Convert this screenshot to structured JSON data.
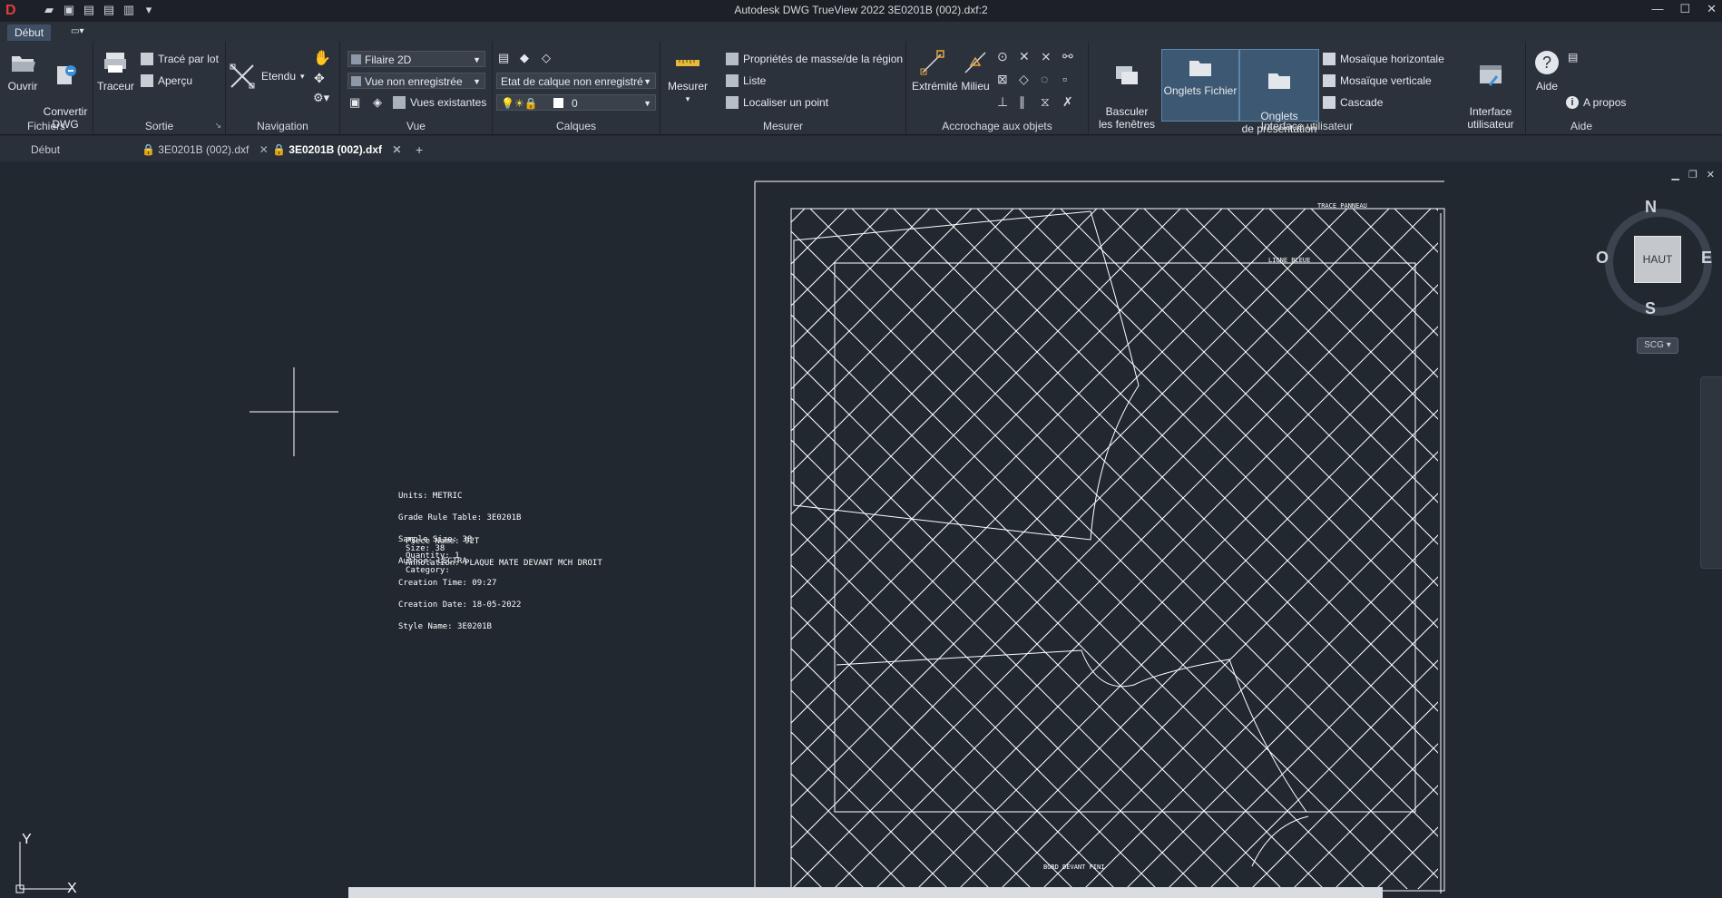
{
  "titlebar": {
    "app_logo": "D",
    "title": "Autodesk DWG TrueView 2022    3E0201B (002).dxf:2",
    "controls": [
      "—",
      "☐",
      "✕"
    ]
  },
  "ribbon_tabs": [
    "Début"
  ],
  "ribbon": {
    "fichiers": {
      "label": "Fichiers",
      "ouvrir": "Ouvrir",
      "convertir": "Convertir\nDWG"
    },
    "sortie": {
      "label": "Sortie",
      "traceur": "Traceur",
      "trace_par_lot": "Tracé par lot",
      "apercu": "Aperçu"
    },
    "navigation": {
      "label": "Navigation",
      "etendu": "Etendu"
    },
    "vue": {
      "label": "Vue",
      "combo_style": "Filaire 2D",
      "combo_vue": "Vue non enregistrée",
      "vues_existantes": "Vues existantes"
    },
    "calques": {
      "label": "Calques",
      "combo_etat": "Etat de calque non enregistré",
      "combo_layer": "0"
    },
    "mesurer": {
      "label": "Mesurer",
      "mesurer_btn": "Mesurer",
      "proprietes": "Propriétés de masse/de la région",
      "liste": "Liste",
      "localiser": "Localiser un point"
    },
    "accrochage": {
      "label": "Accrochage aux objets",
      "extremite": "Extrémité",
      "milieu": "Milieu"
    },
    "interface": {
      "label": "Interface utilisateur",
      "basculer": "Basculer\nles fenêtres",
      "onglets_fichier": "Onglets Fichier",
      "onglets_presentation": "Onglets\nde présentation",
      "mosaique_h": "Mosaïque horizontale",
      "mosaique_v": "Mosaïque verticale",
      "cascade": "Cascade",
      "interface_utilisateur": "Interface\nutilisateur"
    },
    "aide": {
      "label": "Aide",
      "aide_btn": "Aide",
      "a_propos": "A propos"
    }
  },
  "doc_tabs": [
    {
      "label": "Début",
      "active": false
    },
    {
      "label": "3E0201B (002).dxf",
      "active": false
    },
    {
      "label": "3E0201B (002).dxf",
      "active": true
    }
  ],
  "drawing_info": {
    "lines": [
      "Units: METRIC",
      "Grade Rule Table: 3E0201B",
      "Sample Size: 38",
      "Author: LECTRA",
      "Creation Time: 09:27",
      "Creation Date: 18-05-2022",
      "Style Name: 3E0201B"
    ],
    "piece": [
      "Piece Name: 92T",
      "Size: 38",
      "Quantity: 1",
      "Annotation: PLAQUE MATE DEVANT MCH DROIT",
      "Category:"
    ]
  },
  "drawing_labels": {
    "trace_panneau": "TRACE PANNEAU",
    "ligne_bleue": "LIGNE BLEUE",
    "bord_devant": "BORD DEVANT FINI"
  },
  "viewcube": {
    "face": "HAUT",
    "n": "N",
    "s": "S",
    "e": "E",
    "o": "O",
    "scg": "SCG"
  },
  "ucs": {
    "x": "X",
    "y": "Y"
  },
  "colors": {
    "canvas": "#212830",
    "ribbon": "#2c323b",
    "accent": "#3d5873"
  }
}
